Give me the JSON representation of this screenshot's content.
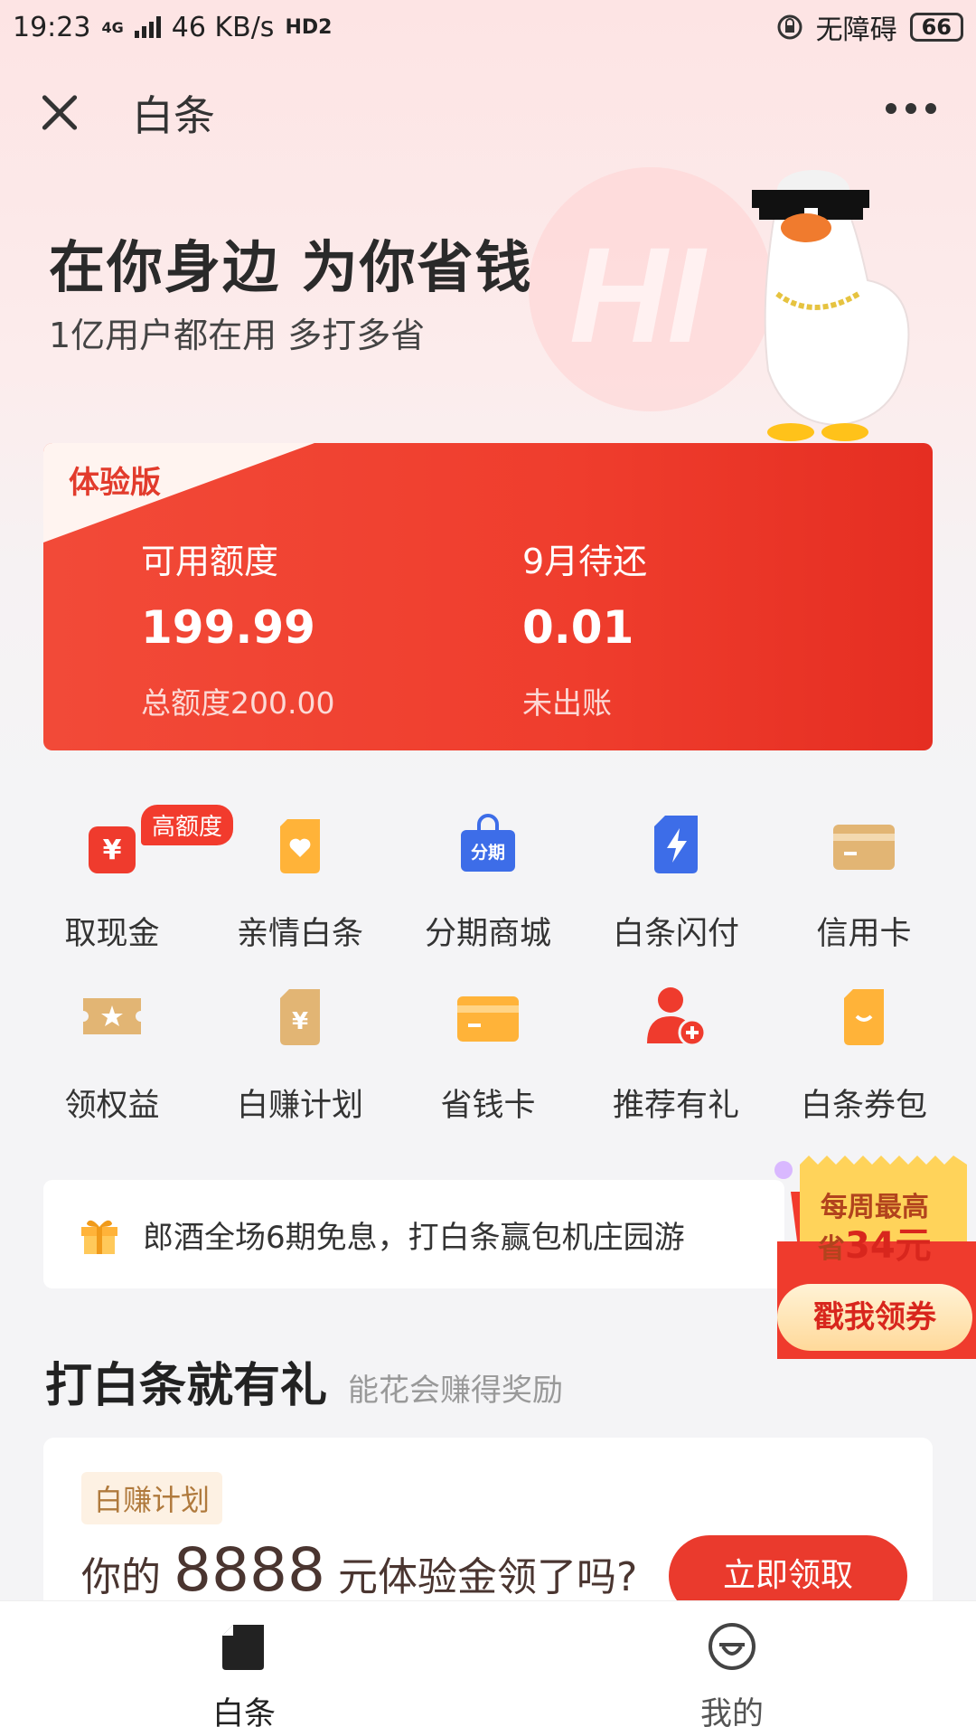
{
  "status_bar": {
    "time": "19:23",
    "network": "4G",
    "speed": "46 KB/s",
    "hd": "HD2",
    "accessibility": "无障碍",
    "battery": "66"
  },
  "nav": {
    "title": "白条"
  },
  "hero": {
    "title": "在你身边 为你省钱",
    "subtitle": "1亿用户都在用 多打多省",
    "watermark": "HI"
  },
  "credit_card": {
    "tag": "体验版",
    "available_label": "可用额度",
    "available_value": "199.99",
    "total_label": "总额度200.00",
    "due_label": "9月待还",
    "due_value": "0.01",
    "due_note": "未出账"
  },
  "menu": [
    {
      "label": "取现金",
      "icon": "cash-icon",
      "color": "#ef3b2d",
      "badge": "高额度"
    },
    {
      "label": "亲情白条",
      "icon": "family-heart-icon",
      "color": "#ffb339"
    },
    {
      "label": "分期商城",
      "icon": "installment-bag-icon",
      "color": "#3d6de8",
      "icon_text": "分期"
    },
    {
      "label": "白条闪付",
      "icon": "flash-pay-icon",
      "color": "#3d6de8"
    },
    {
      "label": "信用卡",
      "icon": "credit-card-icon",
      "color": "#e2b574"
    },
    {
      "label": "领权益",
      "icon": "benefit-ticket-icon",
      "color": "#e2b574"
    },
    {
      "label": "白赚计划",
      "icon": "earn-plan-icon",
      "color": "#e2b574"
    },
    {
      "label": "省钱卡",
      "icon": "saving-card-icon",
      "color": "#ffb339"
    },
    {
      "label": "推荐有礼",
      "icon": "referral-user-icon",
      "color": "#ef3b2d"
    },
    {
      "label": "白条券包",
      "icon": "coupon-wallet-icon",
      "color": "#ffb339"
    }
  ],
  "promo": {
    "text": "郎酒全场6期免息，打白条赢包机庄园游"
  },
  "coupon_float": {
    "line1": "每周最高",
    "line2_prefix": "省",
    "line2_amount": "34元",
    "button": "戳我领券"
  },
  "section": {
    "title": "打白条就有礼",
    "subtitle": "能花会赚得奖励"
  },
  "earn_card": {
    "tag": "白赚计划",
    "prefix": "你的",
    "amount": "8888",
    "suffix": "元体验金领了吗?",
    "button": "立即领取"
  },
  "tabbar": {
    "tab1": "白条",
    "tab2": "我的"
  },
  "colors": {
    "brand_red": "#ef3b2d",
    "gold": "#e2b574",
    "blue": "#3d6de8"
  }
}
